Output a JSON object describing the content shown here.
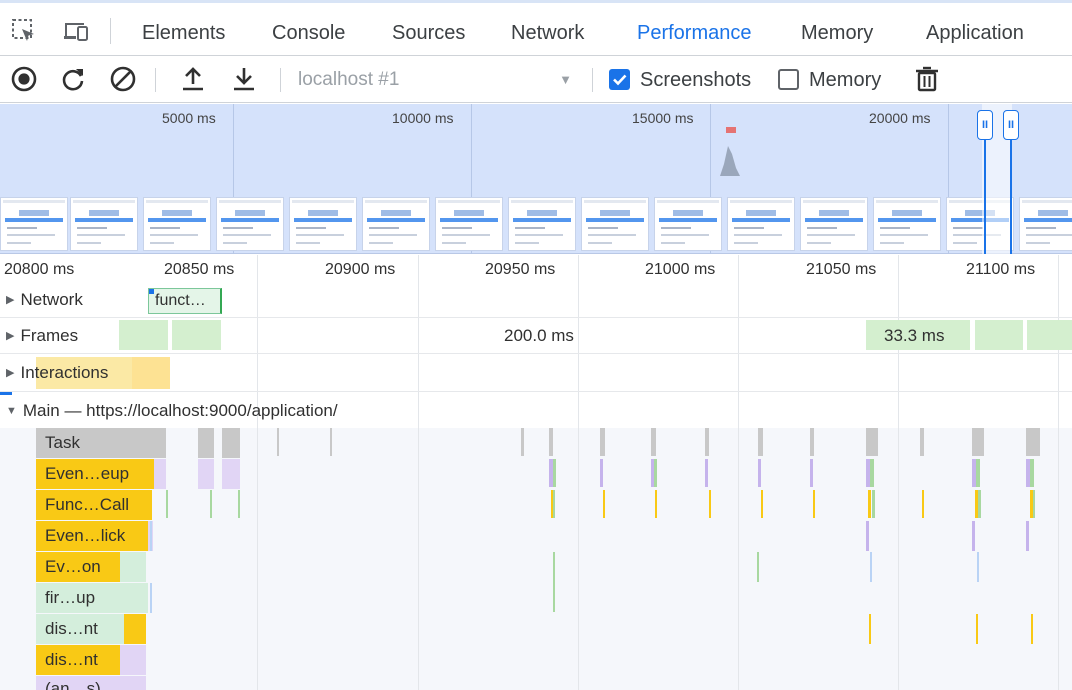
{
  "tabs": {
    "elements": "Elements",
    "console": "Console",
    "sources": "Sources",
    "network": "Network",
    "performance": "Performance",
    "memory": "Memory",
    "application": "Application"
  },
  "toolbar": {
    "profile": "localhost #1",
    "screenshots_label": "Screenshots",
    "screenshots_checked": true,
    "memory_label": "Memory",
    "memory_checked": false
  },
  "overview": {
    "ticks": [
      "5000 ms",
      "10000 ms",
      "15000 ms",
      "20000 ms"
    ],
    "pause_label": "II"
  },
  "ruler": [
    "20800 ms",
    "20850 ms",
    "20900 ms",
    "20950 ms",
    "21000 ms",
    "21050 ms",
    "21100 ms"
  ],
  "tracks": {
    "network": "Network",
    "network_request": "funct…",
    "frames": "Frames",
    "frame_long": "200.0 ms",
    "frame_short": "33.3 ms",
    "interactions": "Interactions",
    "main": "Main — https://localhost:9000/application/"
  },
  "flame": {
    "task": "Task",
    "event_mouseup": "Even…eup",
    "function_call": "Func…Call",
    "event_click": "Even…lick",
    "event_on": "Ev…on",
    "fire_up": "fir…up",
    "dispatch_1": "dis…nt",
    "dispatch_2": "dis…nt",
    "anon": "(an…s)"
  },
  "colors": {
    "accent": "#1a73e8",
    "task": "#c8c8c8",
    "scripting": "#f9c915",
    "rendering": "#e1d5f5",
    "painting": "#d4eedc",
    "frame": "#d4efcf",
    "interaction": "#fde293"
  }
}
